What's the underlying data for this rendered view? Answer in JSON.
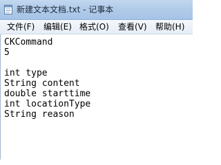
{
  "window": {
    "title": "新建文本文档.txt - 记事本"
  },
  "menu": {
    "file": "文件(F)",
    "edit": "编辑(E)",
    "format": "格式(O)",
    "view": "查看(V)",
    "help": "帮助(H)"
  },
  "editor": {
    "lines": [
      "CKCommand",
      "5",
      "",
      "int type",
      "String content",
      "double starttime",
      "int locationType",
      "String reason"
    ]
  }
}
